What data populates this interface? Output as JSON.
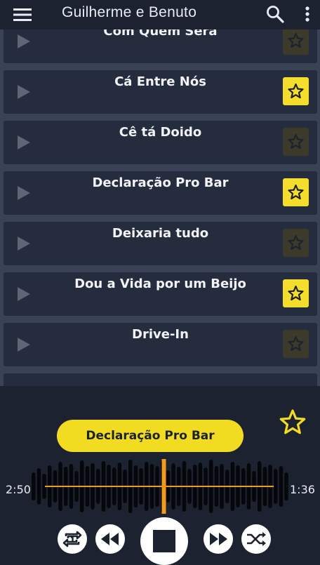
{
  "header": {
    "title": "Guilherme e Benuto",
    "menu_icon": "hamburger-menu-icon",
    "search_icon": "search-icon",
    "more_icon": "more-vert-icon"
  },
  "songs": [
    {
      "title": "Com Quem Sera",
      "favorite": false
    },
    {
      "title": "Cá Entre Nós",
      "favorite": true
    },
    {
      "title": "Cê tá Doido",
      "favorite": false
    },
    {
      "title": "Declaração Pro Bar",
      "favorite": true
    },
    {
      "title": "Deixaria tudo",
      "favorite": false
    },
    {
      "title": "Dou a Vida por um Beijo",
      "favorite": true
    },
    {
      "title": "Drive-In",
      "favorite": false
    }
  ],
  "player": {
    "now_playing": "Declaração Pro Bar",
    "elapsed": "2:50",
    "remaining": "1:36",
    "progress": 0.52
  },
  "colors": {
    "background": "#1c2230",
    "row": "#252c3d",
    "accent": "#f2dc22",
    "progress": "#f29a1a"
  }
}
